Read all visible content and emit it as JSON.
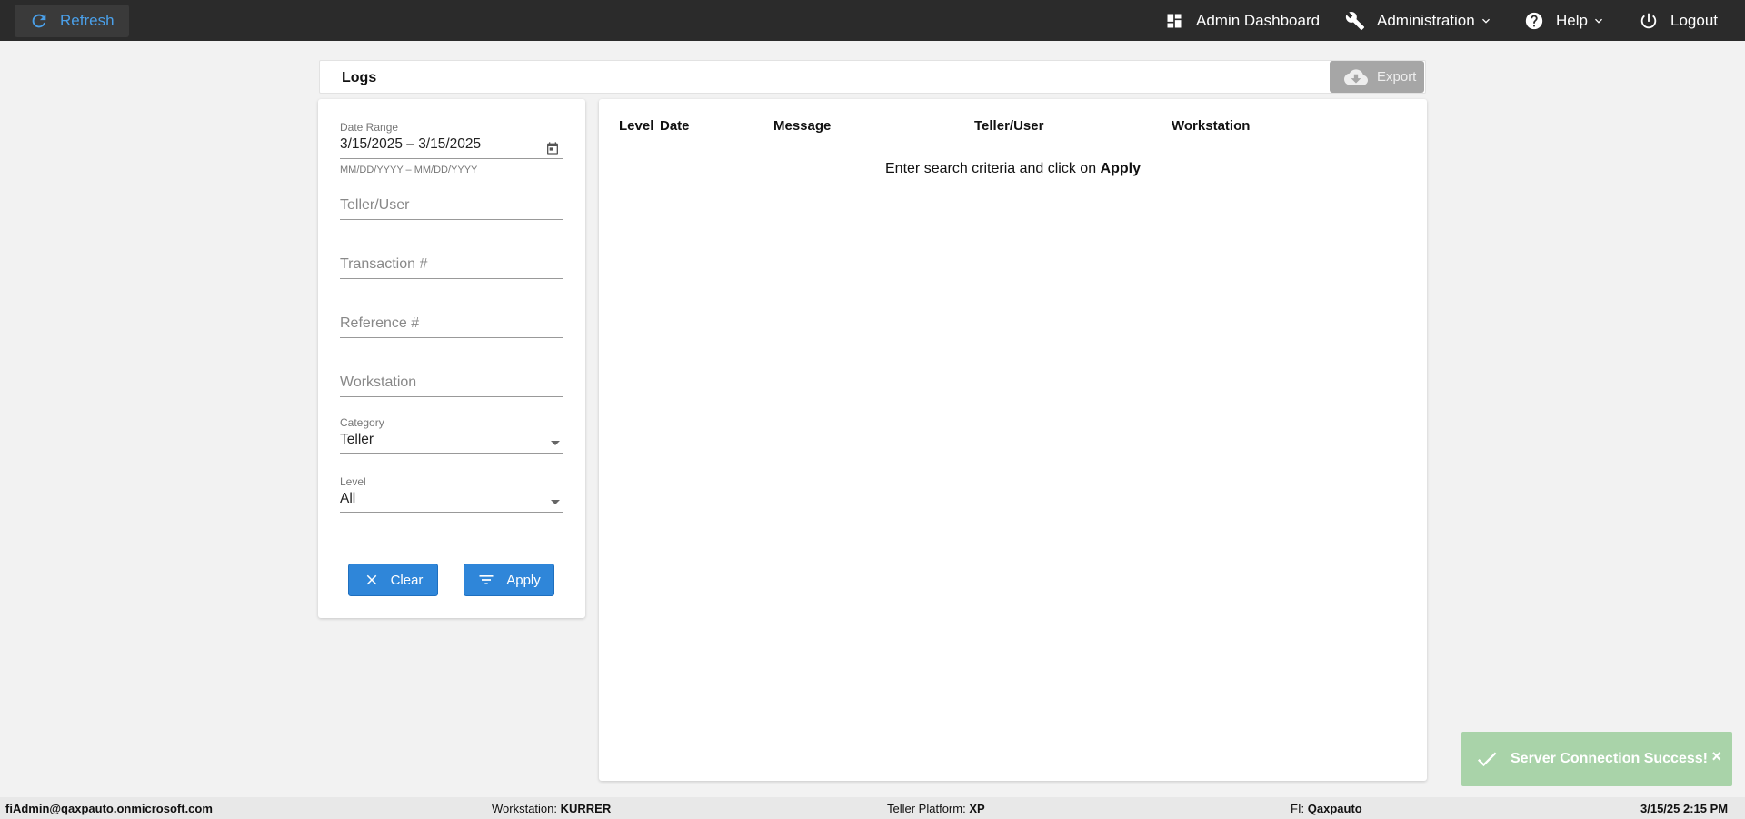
{
  "topbar": {
    "refresh_label": "Refresh",
    "nav": {
      "admin_dashboard": "Admin Dashboard",
      "administration": "Administration",
      "help": "Help",
      "logout": "Logout"
    }
  },
  "logs": {
    "title": "Logs",
    "export_label": "Export"
  },
  "filters": {
    "date_range_label": "Date Range",
    "date_range_value": "3/15/2025 – 3/15/2025",
    "date_range_hint": "MM/DD/YYYY – MM/DD/YYYY",
    "teller_user_placeholder": "Teller/User",
    "transaction_placeholder": "Transaction #",
    "reference_placeholder": "Reference #",
    "workstation_placeholder": "Workstation",
    "category_label": "Category",
    "category_value": "Teller",
    "level_label": "Level",
    "level_value": "All",
    "clear_label": "Clear",
    "apply_label": "Apply"
  },
  "results": {
    "columns": [
      "Level",
      "Date",
      "Message",
      "Teller/User",
      "Workstation"
    ],
    "empty_prefix": "Enter search criteria and click on ",
    "empty_action": "Apply"
  },
  "toast": {
    "message": "Server Connection Success!",
    "close": "×"
  },
  "statusbar": {
    "user": "fiAdmin@qaxpauto.onmicrosoft.com",
    "workstation_label": "Workstation: ",
    "workstation_value": "KURRER",
    "platform_label": "Teller Platform: ",
    "platform_value": "XP",
    "fi_label": "FI: ",
    "fi_value": "Qaxpauto",
    "datetime": "3/15/25 2:15 PM"
  },
  "colors": {
    "topbar_bg": "#2b2b2b",
    "accent_blue": "#2f86d9",
    "refresh_text": "#4a9fe8",
    "toast_green": "#a9d3a9",
    "export_disabled": "#a6a6a6"
  }
}
